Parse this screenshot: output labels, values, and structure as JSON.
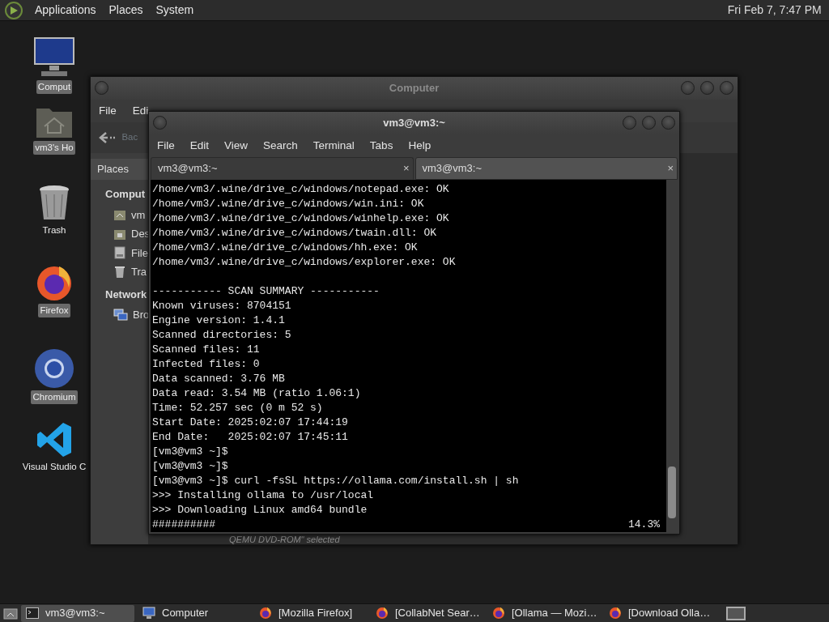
{
  "top_panel": {
    "menus": [
      "Applications",
      "Places",
      "System"
    ],
    "clock": "Fri Feb  7,  7:47 PM"
  },
  "desktop_icons": [
    {
      "kind": "computer",
      "label": "Comput"
    },
    {
      "kind": "home",
      "label": "vm3's Ho"
    },
    {
      "kind": "trash",
      "label": "Trash"
    },
    {
      "kind": "firefox",
      "label": "Firefox"
    },
    {
      "kind": "chromium",
      "label": "Chromium"
    },
    {
      "kind": "vscode",
      "label": "Visual Studio C"
    }
  ],
  "file_manager": {
    "title": "Computer",
    "menus": [
      "File",
      "Edi"
    ],
    "back_button": "Bac",
    "places_selector": "Places",
    "sections": [
      {
        "heading": "Comput",
        "items": [
          {
            "kind": "home",
            "label": "vm"
          },
          {
            "kind": "desktop",
            "label": "Des"
          },
          {
            "kind": "filesystem",
            "label": "File"
          },
          {
            "kind": "trash",
            "label": "Tra"
          }
        ]
      },
      {
        "heading": "Network",
        "items": [
          {
            "kind": "network",
            "label": "Bro"
          }
        ]
      }
    ],
    "status": "QEMU DVD-ROM\" selected"
  },
  "terminal": {
    "title": "vm3@vm3:~",
    "menus": [
      "File",
      "Edit",
      "View",
      "Search",
      "Terminal",
      "Tabs",
      "Help"
    ],
    "tabs": [
      {
        "label": "vm3@vm3:~",
        "close": "×",
        "selected": true
      },
      {
        "label": "vm3@vm3:~",
        "close": "×",
        "selected": false
      }
    ],
    "output_blocks": [
      [
        "/home/vm3/.wine/drive_c/windows/notepad.exe: OK",
        "/home/vm3/.wine/drive_c/windows/win.ini: OK",
        "/home/vm3/.wine/drive_c/windows/winhelp.exe: OK",
        "/home/vm3/.wine/drive_c/windows/twain.dll: OK",
        "/home/vm3/.wine/drive_c/windows/hh.exe: OK",
        "/home/vm3/.wine/drive_c/windows/explorer.exe: OK"
      ],
      [
        "----------- SCAN SUMMARY -----------",
        "Known viruses: 8704151",
        "Engine version: 1.4.1",
        "Scanned directories: 5",
        "Scanned files: 11",
        "Infected files: 0",
        "Data scanned: 3.76 MB",
        "Data read: 3.54 MB (ratio 1.06:1)",
        "Time: 52.257 sec (0 m 52 s)",
        "Start Date: 2025:02:07 17:44:19",
        "End Date:   2025:02:07 17:45:11",
        "[vm3@vm3 ~]$",
        "[vm3@vm3 ~]$",
        "[vm3@vm3 ~]$ curl -fsSL https://ollama.com/install.sh | sh",
        ">>> Installing ollama to /usr/local",
        ">>> Downloading Linux amd64 bundle"
      ]
    ],
    "progress": {
      "bar": "##########",
      "percent": "14.3%"
    }
  },
  "taskbar": {
    "items": [
      {
        "kind": "terminal",
        "label": "vm3@vm3:~",
        "selected": true
      },
      {
        "kind": "computer",
        "label": "Computer",
        "selected": false
      },
      {
        "kind": "firefox",
        "label": "[Mozilla Firefox]",
        "selected": false
      },
      {
        "kind": "firefox",
        "label": "[CollabNet Sear…",
        "selected": false
      },
      {
        "kind": "firefox",
        "label": "[Ollama — Mozi…",
        "selected": false
      },
      {
        "kind": "firefox",
        "label": "[Download Olla…",
        "selected": false
      }
    ]
  }
}
